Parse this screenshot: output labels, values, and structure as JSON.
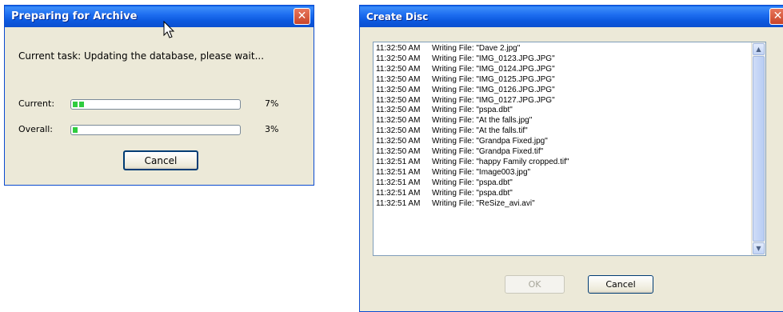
{
  "archive_dialog": {
    "title": "Preparing for Archive",
    "close_glyph": "✕",
    "task_text": "Current task: Updating the database, please wait...",
    "current_label": "Current:",
    "current_percent_text": "7%",
    "current_progress": 0.07,
    "overall_label": "Overall:",
    "overall_percent_text": "3%",
    "overall_progress": 0.03,
    "cancel_label": "Cancel"
  },
  "create_disc_dialog": {
    "title": "Create Disc",
    "close_glyph": "✕",
    "log": [
      {
        "time": "11:32:50 AM",
        "message": "Writing File: \"Dave 2.jpg\""
      },
      {
        "time": "11:32:50 AM",
        "message": "Writing File: \"IMG_0123.JPG.JPG\""
      },
      {
        "time": "11:32:50 AM",
        "message": "Writing File: \"IMG_0124.JPG.JPG\""
      },
      {
        "time": "11:32:50 AM",
        "message": "Writing File: \"IMG_0125.JPG.JPG\""
      },
      {
        "time": "11:32:50 AM",
        "message": "Writing File: \"IMG_0126.JPG.JPG\""
      },
      {
        "time": "11:32:50 AM",
        "message": "Writing File: \"IMG_0127.JPG.JPG\""
      },
      {
        "time": "11:32:50 AM",
        "message": "Writing File: \"pspa.dbt\""
      },
      {
        "time": "11:32:50 AM",
        "message": "Writing File: \"At the falls.jpg\""
      },
      {
        "time": "11:32:50 AM",
        "message": "Writing File: \"At the falls.tif\""
      },
      {
        "time": "11:32:50 AM",
        "message": "Writing File: \"Grandpa Fixed.jpg\""
      },
      {
        "time": "11:32:50 AM",
        "message": "Writing File: \"Grandpa Fixed.tif\""
      },
      {
        "time": "11:32:51 AM",
        "message": "Writing File: \"happy Family cropped.tif\""
      },
      {
        "time": "11:32:51 AM",
        "message": "Writing File: \"Image003.jpg\""
      },
      {
        "time": "11:32:51 AM",
        "message": "Writing File: \"pspa.dbt\""
      },
      {
        "time": "11:32:51 AM",
        "message": "Writing File: \"pspa.dbt\""
      },
      {
        "time": "11:32:51 AM",
        "message": "Writing File: \"ReSize_avi.avi\""
      }
    ],
    "scroll_up_glyph": "▲",
    "scroll_down_glyph": "▼",
    "ok_label": "OK",
    "cancel_label": "Cancel"
  },
  "cursor_icon": "arrow-pointer"
}
